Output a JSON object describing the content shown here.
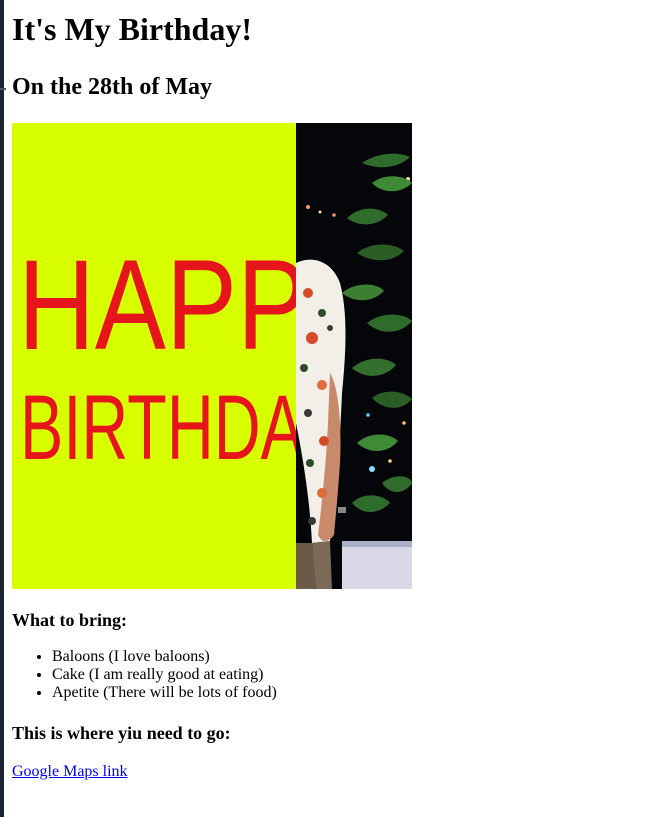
{
  "page": {
    "title": "It's My Birthday!",
    "date_heading": "On the 28th of May"
  },
  "image": {
    "banner_line1": "HAPP",
    "banner_line2": "BIRTHDA",
    "banner_background": "#d7ff00",
    "banner_text_color": "#e5151b"
  },
  "bring": {
    "heading": "What to bring:",
    "items": [
      "Baloons (I love baloons)",
      "Cake (I am really good at eating)",
      "Apetite (There will be lots of food)"
    ]
  },
  "directions": {
    "heading": "This is where yiu need to go:",
    "link_text": "Google Maps link"
  },
  "colors": {
    "link": "#0000ee"
  }
}
